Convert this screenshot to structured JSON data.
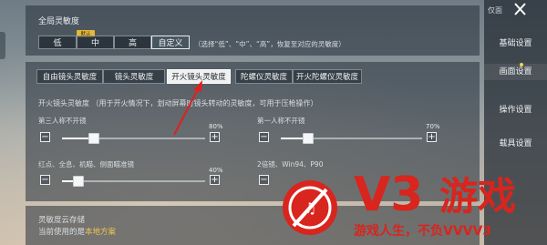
{
  "global": {
    "title": "全局灵敏度",
    "options": [
      "低",
      "中",
      "高",
      "自定义"
    ],
    "default_badge": "默认",
    "hint": "（选择“低”、“中”、“高”，恢复至对应的灵敏度）"
  },
  "tabs": [
    "自由镜头灵敏度",
    "镜头灵敏度",
    "开火镜头灵敏度",
    "陀螺仪灵敏度",
    "开火陀螺仪灵敏度"
  ],
  "active_tab": "开火镜头灵敏度",
  "fire": {
    "desc": "开火镜头灵敏度 （用于开火情况下，划动屏幕时镜头转动的灵敏度，可用于压枪操作）",
    "sliders": [
      {
        "label": "第三人称不开镜",
        "value_text": "80%",
        "value": 0.8
      },
      {
        "label": "第一人称不开镜",
        "value_text": "70%",
        "value": 0.7
      },
      {
        "label": "红点、全息、机瞄、侧面瞄准镜",
        "value_text": "40%",
        "value": 0.4
      },
      {
        "label": "2倍镜、Win94、P90",
        "value_text": "",
        "value": 0.4
      }
    ]
  },
  "cloud": {
    "title": "灵敏度云存储",
    "current_prefix": "当前使用的是",
    "current_value": "本地方案"
  },
  "sidebar": {
    "top_button": "仅面",
    "items": [
      "基础设置",
      "画面设置",
      "操作设置",
      "载具设置"
    ],
    "active_index": 1
  },
  "watermark": {
    "brand": "V3",
    "name": "游戏",
    "slogan": "游戏人生，不负VVVV3"
  },
  "colors": {
    "accent_yellow": "#e4b83a",
    "highlight_text": "#f2c550",
    "watermark_red": "#d8251d",
    "arrow_red": "#e02020"
  }
}
